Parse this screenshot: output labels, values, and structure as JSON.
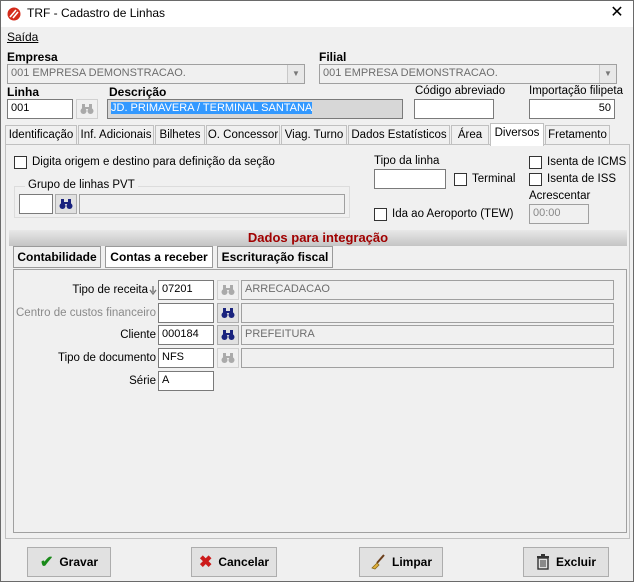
{
  "window": {
    "title": "TRF - Cadastro de Linhas",
    "close_glyph": "✕"
  },
  "menu": {
    "saida": "Saída"
  },
  "empresa": {
    "label": "Empresa",
    "value": "001 EMPRESA DEMONSTRACAO."
  },
  "filial": {
    "label": "Filial",
    "value": "001 EMPRESA DEMONSTRACAO."
  },
  "linha": {
    "label": "Linha",
    "value": "001"
  },
  "descricao": {
    "label": "Descrição",
    "value": "JD. PRIMAVERA / TERMINAL SANTANA"
  },
  "codigo_abreviado": {
    "label": "Código abreviado",
    "value": ""
  },
  "importacao_filipeta": {
    "label": "Importação filipeta",
    "value": "50"
  },
  "tabs": [
    {
      "label": "Identificação"
    },
    {
      "label": "Inf. Adicionais"
    },
    {
      "label": "Bilhetes"
    },
    {
      "label": "O. Concessor"
    },
    {
      "label": "Viag. Turno"
    },
    {
      "label": "Dados Estatísticos"
    },
    {
      "label": "Área"
    },
    {
      "label": "Diversos"
    },
    {
      "label": "Fretamento"
    }
  ],
  "diversos": {
    "digita_origem_label": "Digita origem e destino para definição da seção",
    "grupo_pvt_label": "Grupo de linhas PVT",
    "tipo_linha_label": "Tipo da linha",
    "terminal_label": "Terminal",
    "ida_aeroporto_label": "Ida ao Aeroporto (TEW)",
    "isenta_icms_label": "Isenta de ICMS",
    "isenta_iss_label": "Isenta de ISS",
    "acrescentar_label": "Acrescentar",
    "acrescentar_value": "00:00"
  },
  "integracao": {
    "header": "Dados para integração",
    "subtabs": [
      {
        "label": "Contabilidade"
      },
      {
        "label": "Contas a receber"
      },
      {
        "label": "Escrituração fiscal"
      }
    ],
    "tipo_receita": {
      "label": "Tipo de receita",
      "code": "07201",
      "desc": "ARRECADACAO"
    },
    "centro_custos": {
      "label": "Centro de custos financeiro",
      "code": "",
      "desc": ""
    },
    "cliente": {
      "label": "Cliente",
      "code": "000184",
      "desc": "PREFEITURA"
    },
    "tipo_documento": {
      "label": "Tipo de documento",
      "code": "NFS",
      "desc": ""
    },
    "serie": {
      "label": "Série",
      "value": "A"
    }
  },
  "buttons": {
    "gravar": "Gravar",
    "cancelar": "Cancelar",
    "limpar": "Limpar",
    "excluir": "Excluir"
  }
}
